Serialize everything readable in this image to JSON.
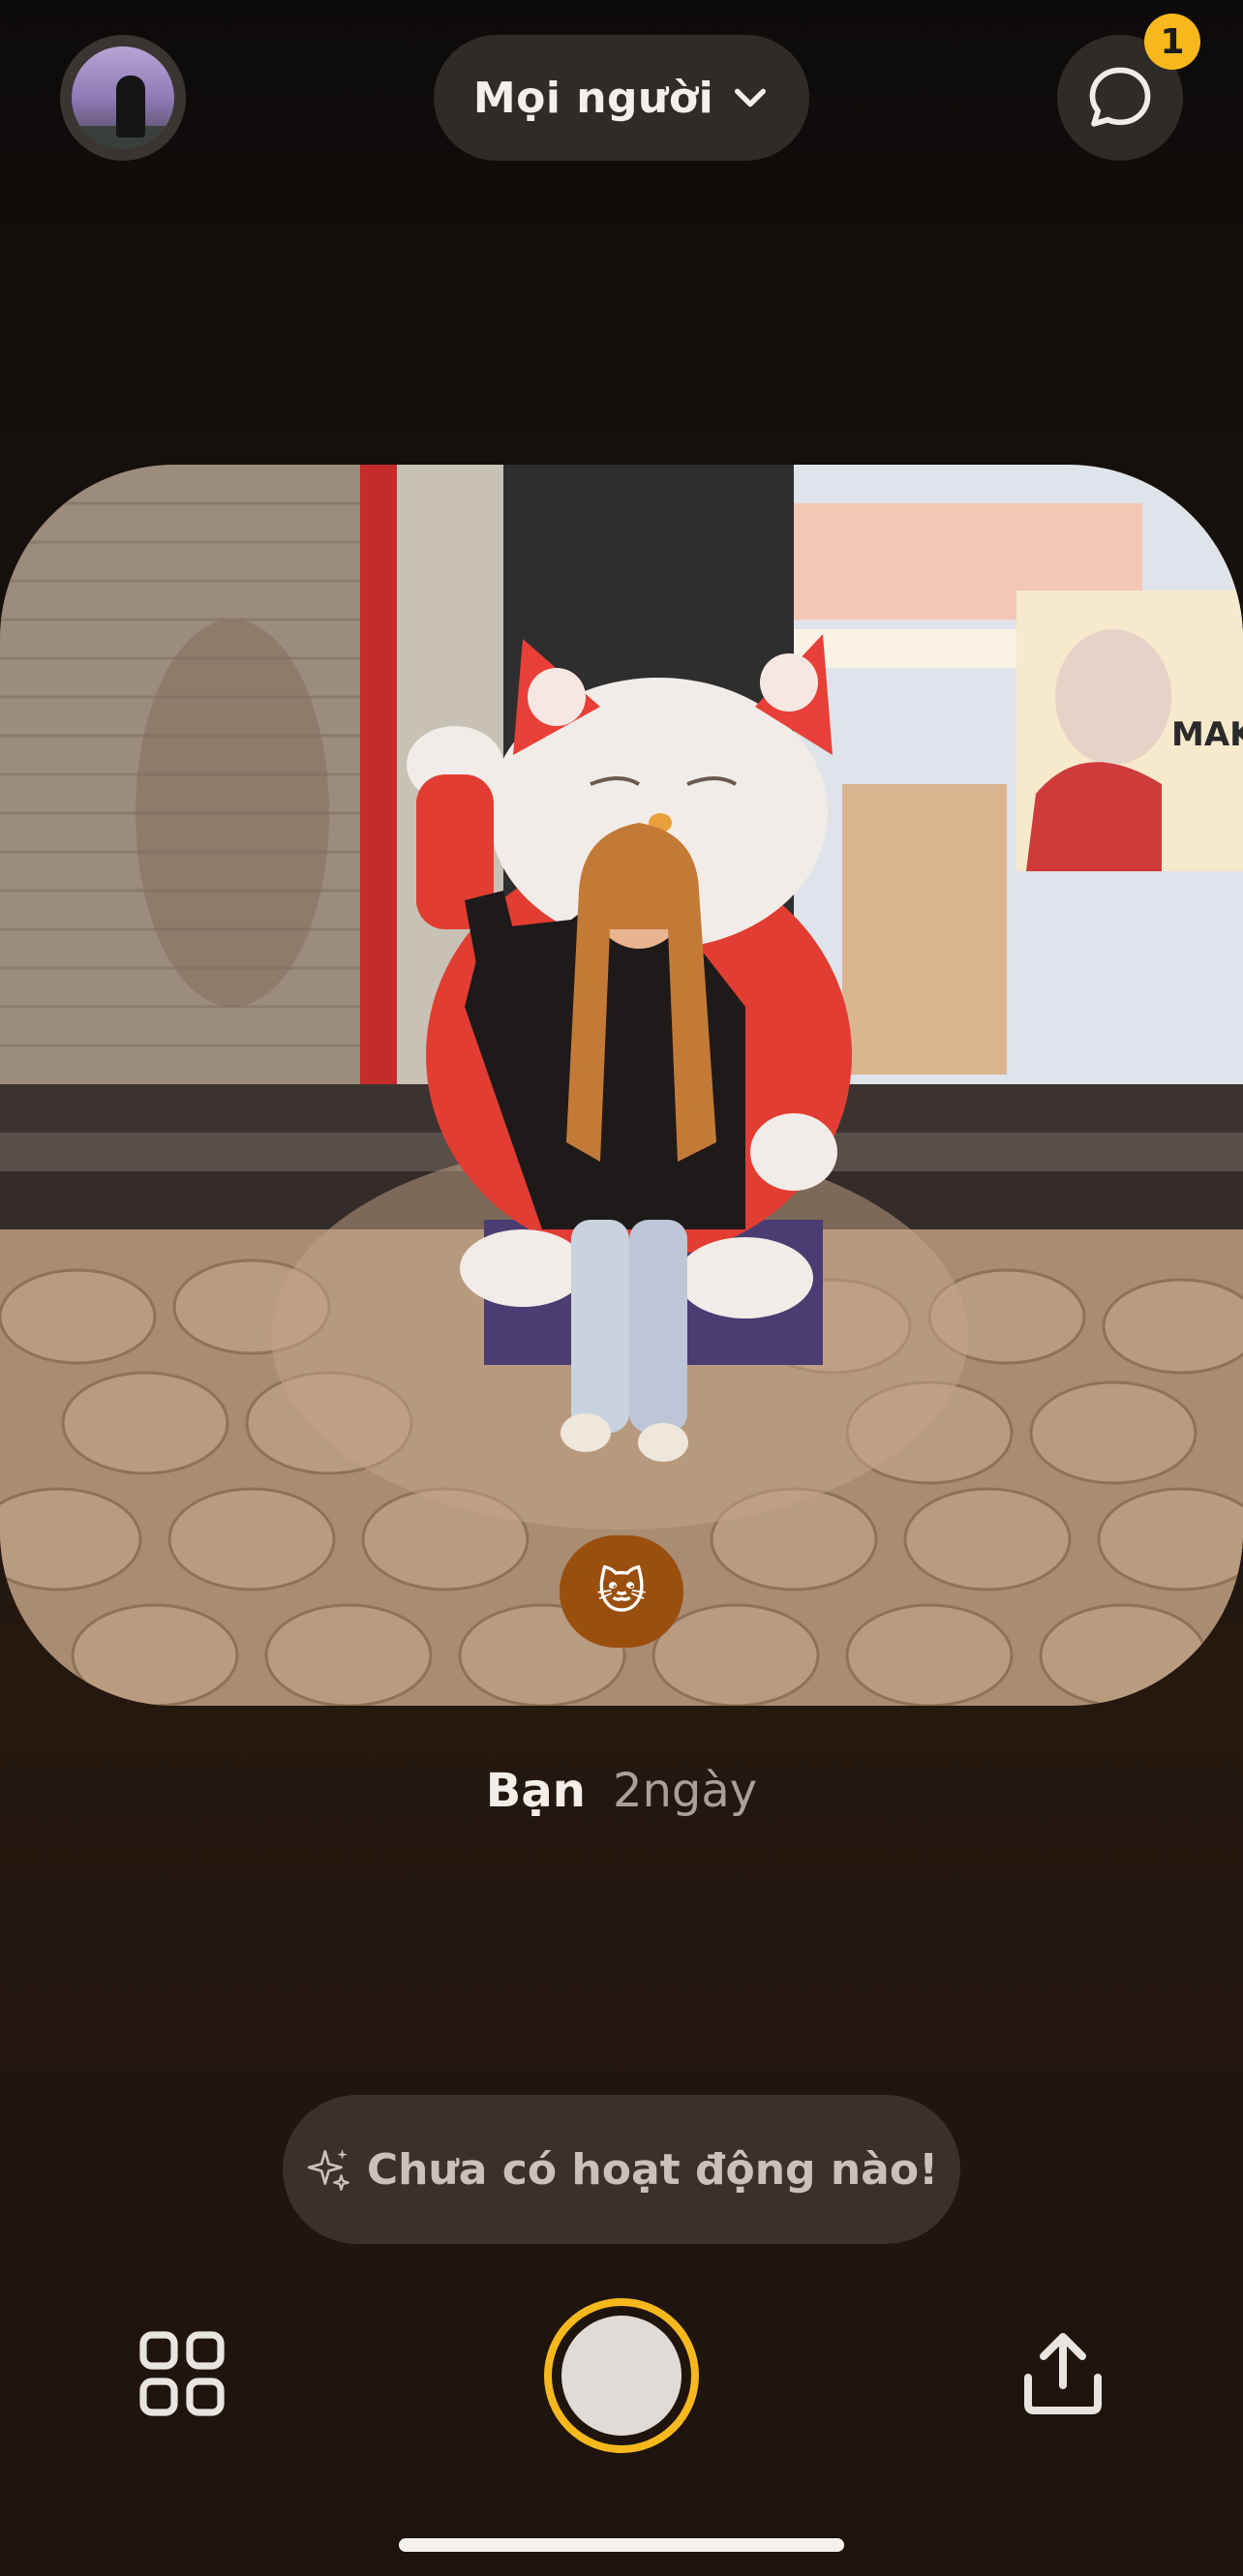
{
  "header": {
    "audience_label": "Mọi người",
    "chat_badge_count": "1"
  },
  "photo": {
    "reaction_emoji": "🐱",
    "sign_text": "MAKO"
  },
  "caption": {
    "author": "Bạn",
    "time": "2ngày"
  },
  "activity": {
    "text": "Chưa có hoạt động nào!"
  },
  "colors": {
    "accent": "#f6b81c",
    "pill_bg": "#3b302a",
    "button_bg": "#2f2b28"
  },
  "icons": {
    "audience_chevron": "chevron-down-icon",
    "chat": "chat-bubble-icon",
    "activity": "sparkle-icon",
    "grid": "grid-icon",
    "share": "share-icon"
  }
}
